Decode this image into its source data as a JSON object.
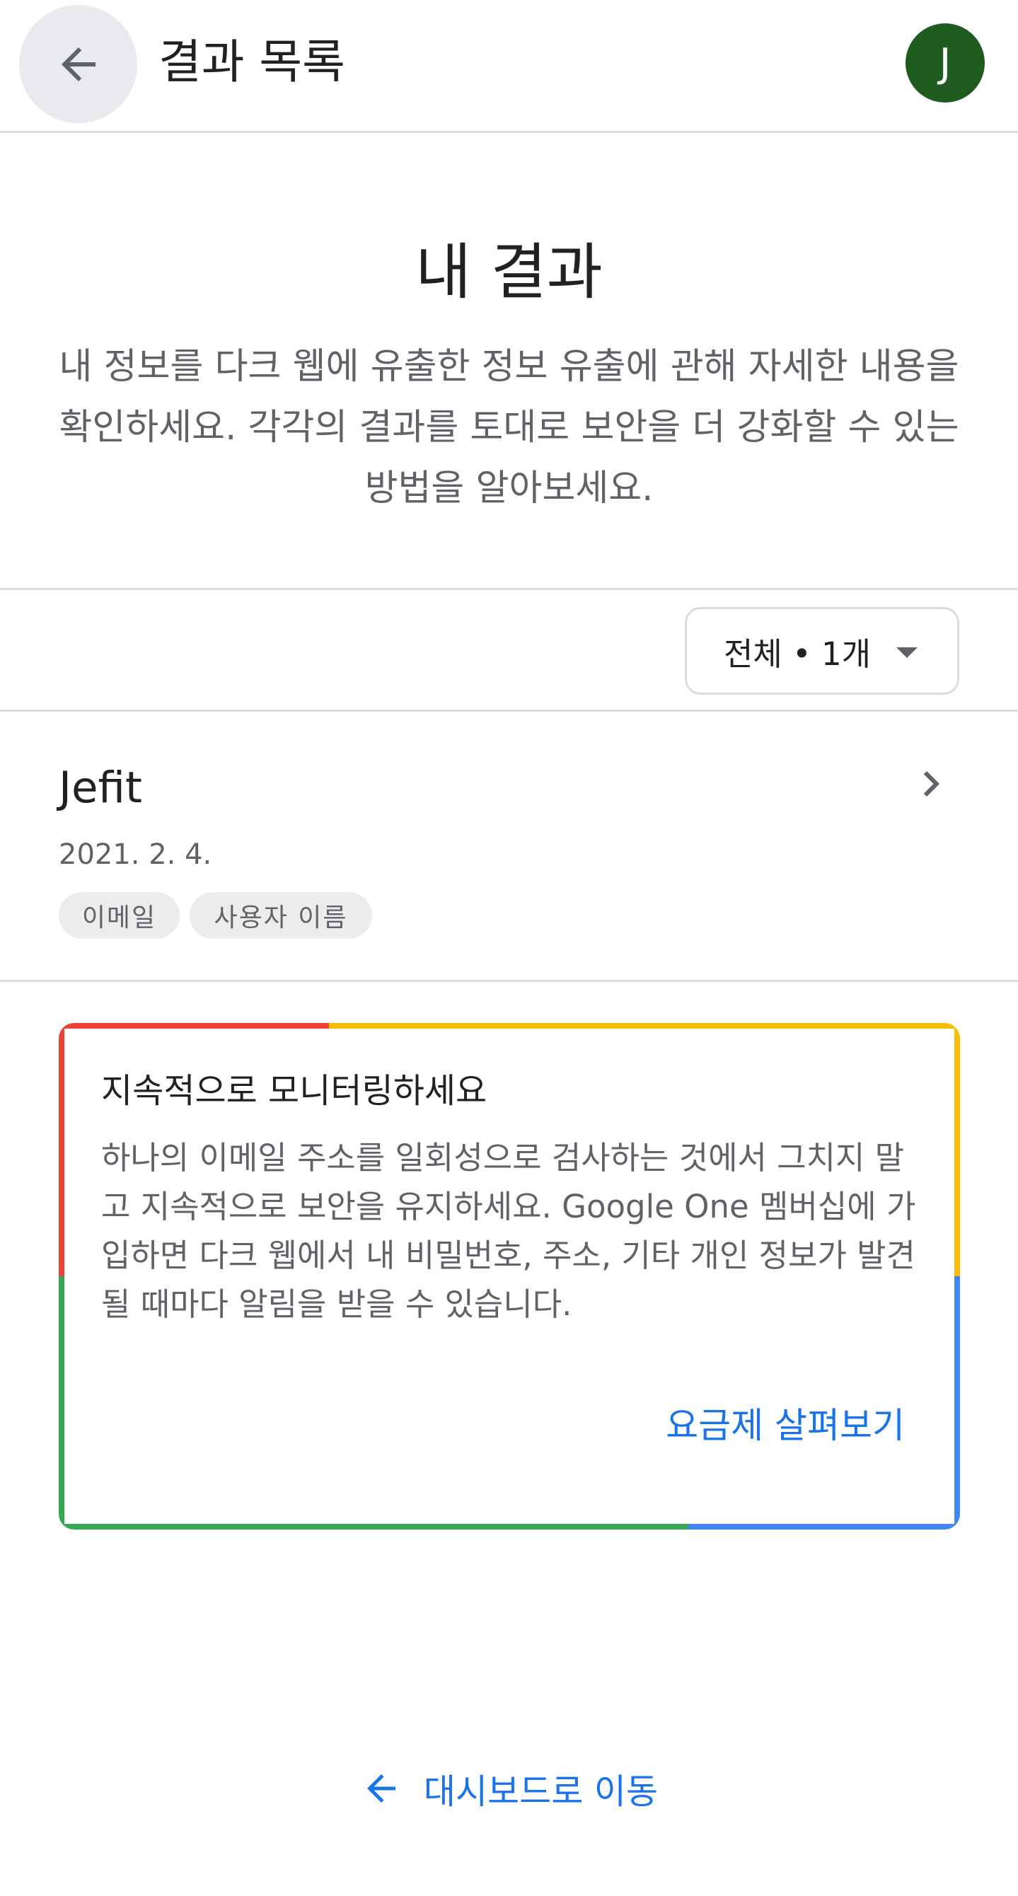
{
  "appbar": {
    "title": "결과 목록",
    "avatar_initial": "J",
    "back_icon": "arrow-back-icon",
    "avatar_color": "#1e5b1f"
  },
  "hero": {
    "title": "내 결과",
    "description": "내 정보를 다크 웹에 유출한 정보 유출에 관해 자세한 내용을 확인하세요. 각각의 결과를 토대로 보안을 더 강화할 수 있는 방법을 알아보세요."
  },
  "filter": {
    "selected": "전체 • 1개"
  },
  "results": [
    {
      "title": "Jefit",
      "date": "2021. 2. 4.",
      "chips": [
        "이메일",
        "사용자 이름"
      ]
    }
  ],
  "promo": {
    "title": "지속적으로 모니터링하세요",
    "body": "하나의 이메일 주소를 일회성으로 검사하는 것에서 그치지 말고 지속적으로 보안을 유지하세요. Google One 멤버십에 가입하면 다크 웹에서 내 비밀번호, 주소, 기타 개인 정보가 발견될 때마다 알림을 받을 수 있습니다.",
    "link_label": "요금제 살펴보기",
    "border_colors": [
      "#ea4335",
      "#fbbc04",
      "#34a853",
      "#4285f4"
    ]
  },
  "footer": {
    "dashboard_link": "대시보드로 이동"
  },
  "colors": {
    "link": "#1a73e8",
    "divider": "#dadce0"
  }
}
